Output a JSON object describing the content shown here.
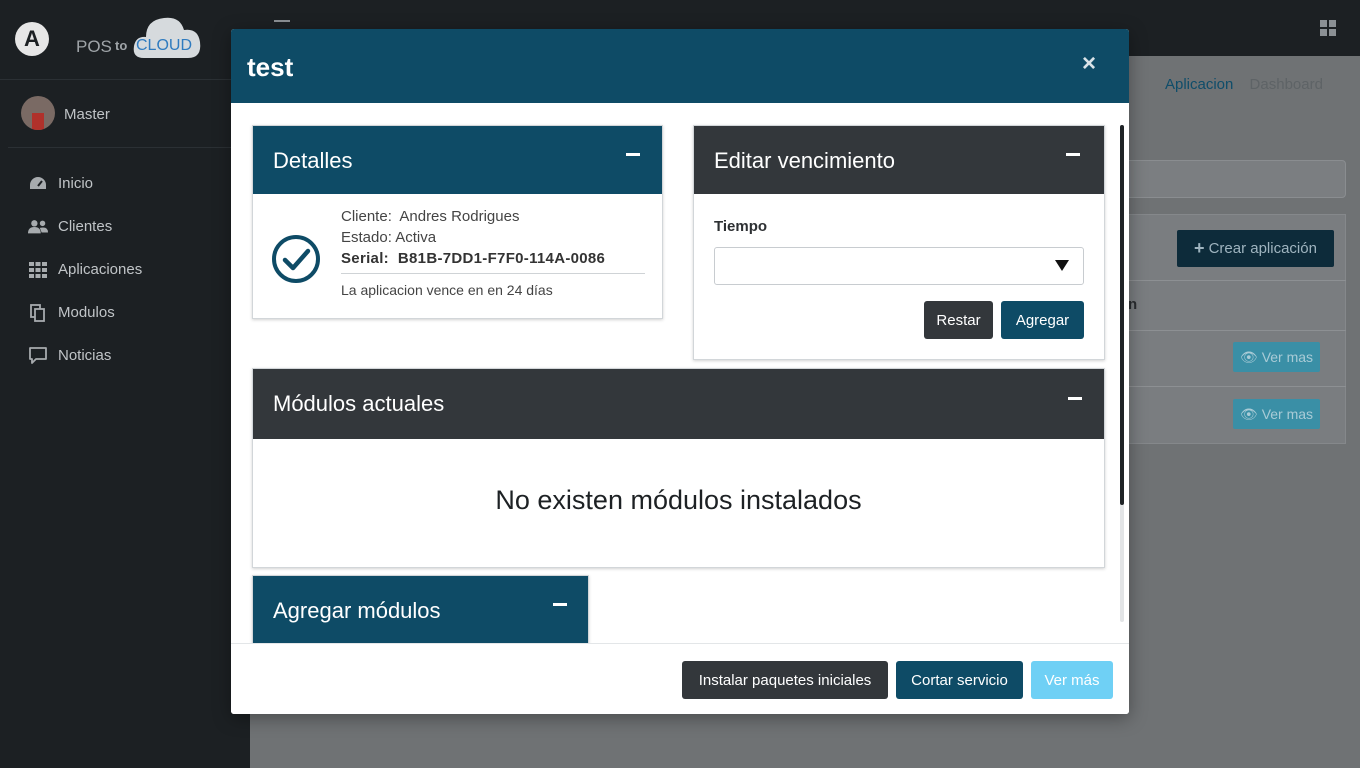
{
  "brand": {
    "text_pos": "POS",
    "text_to": "to",
    "text_cloud": "CLOUD"
  },
  "user": {
    "name": "Master"
  },
  "sidebar": {
    "items": [
      {
        "label": "Inicio",
        "icon": "dashboard-icon"
      },
      {
        "label": "Clientes",
        "icon": "users-icon"
      },
      {
        "label": "Aplicaciones",
        "icon": "grid-icon"
      },
      {
        "label": "Modulos",
        "icon": "copy-icon"
      },
      {
        "label": "Noticias",
        "icon": "comment-icon"
      }
    ]
  },
  "breadcrumb": {
    "parent": "Aplicacion",
    "separator": "/",
    "current": "Dashboard"
  },
  "background": {
    "create_button": "Crear aplicación",
    "col_fragment": "n",
    "row_button_1": "Ver mas",
    "row_button_2": "Ver mas"
  },
  "modal": {
    "title": "test",
    "close": "×",
    "details": {
      "title": "Detalles",
      "cliente_label": "Cliente:",
      "cliente_value": "Andres Rodrigues",
      "estado_label": "Estado:",
      "estado_value": "Activa",
      "serial_label": "Serial:",
      "serial_value": "B81B-7DD1-F7F0-114A-0086",
      "expiry": "La aplicacion vence en en 24 días"
    },
    "expiry_edit": {
      "title": "Editar vencimiento",
      "field_label": "Tiempo",
      "select_value": "",
      "restar": "Restar",
      "agregar": "Agregar"
    },
    "current_modules": {
      "title": "Módulos actuales",
      "empty_text": "No existen módulos instalados"
    },
    "add_modules": {
      "title": "Agregar módulos"
    },
    "footer": {
      "install": "Instalar paquetes iniciales",
      "cut": "Cortar servicio",
      "more": "Ver más"
    }
  },
  "colors": {
    "primary": "#0e4b66",
    "dark": "#33373b",
    "info": "#6fd0f5",
    "sidebar": "#1c2023"
  }
}
